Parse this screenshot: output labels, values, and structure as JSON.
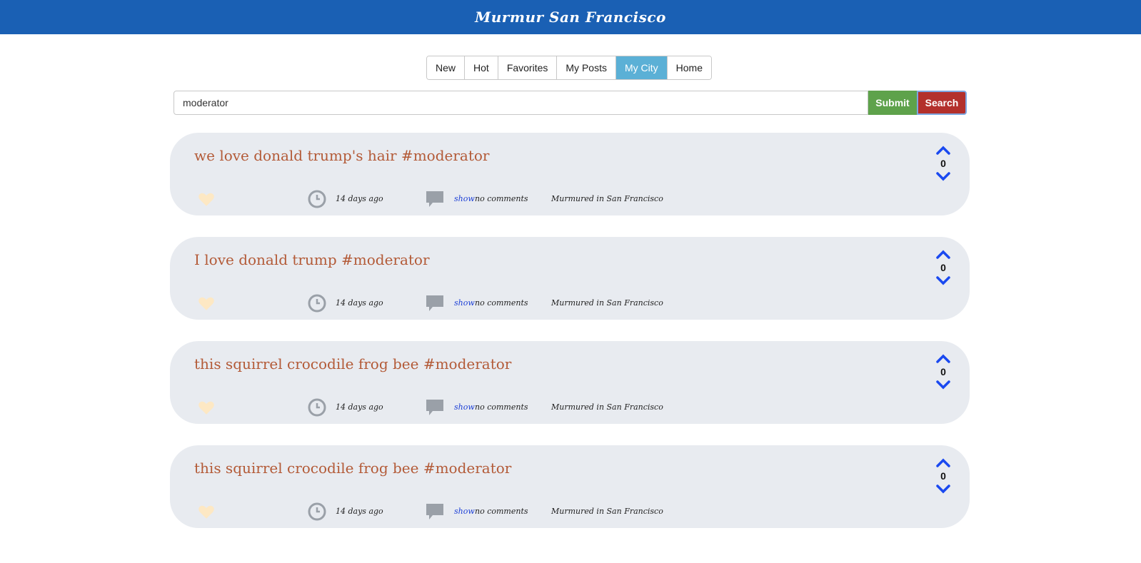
{
  "header": {
    "title": "Murmur San Francisco"
  },
  "tabs": [
    {
      "label": "New",
      "active": false
    },
    {
      "label": "Hot",
      "active": false
    },
    {
      "label": "Favorites",
      "active": false
    },
    {
      "label": "My Posts",
      "active": false
    },
    {
      "label": "My City",
      "active": true
    },
    {
      "label": "Home",
      "active": false
    }
  ],
  "search": {
    "value": "moderator",
    "submit_label": "Submit",
    "search_label": "Search"
  },
  "posts": [
    {
      "title": "we love donald trump's hair #moderator",
      "time": "14 days ago",
      "show_label": "show",
      "comments": "no comments",
      "location": "Murmured in San Francisco",
      "votes": "0"
    },
    {
      "title": "I love donald trump #moderator",
      "time": "14 days ago",
      "show_label": "show",
      "comments": "no comments",
      "location": "Murmured in San Francisco",
      "votes": "0"
    },
    {
      "title": "this squirrel crocodile frog bee #moderator",
      "time": "14 days ago",
      "show_label": "show",
      "comments": "no comments",
      "location": "Murmured in San Francisco",
      "votes": "0"
    },
    {
      "title": "this squirrel crocodile frog bee #moderator",
      "time": "14 days ago",
      "show_label": "show",
      "comments": "no comments",
      "location": "Murmured in San Francisco",
      "votes": "0"
    }
  ],
  "colors": {
    "header": "#1a60b4",
    "active_tab": "#5bb0d6",
    "submit": "#5ea24b",
    "search": "#b3302c",
    "post_bg": "#e8ebf0",
    "title": "#b35a37",
    "link": "#1c3fd6",
    "vote_arrow": "#1a49f0"
  },
  "icons": {
    "favorite": "heart-icon",
    "time": "clock-icon",
    "comments": "comment-bubble-icon",
    "upvote": "chevron-up-icon",
    "downvote": "chevron-down-icon"
  }
}
